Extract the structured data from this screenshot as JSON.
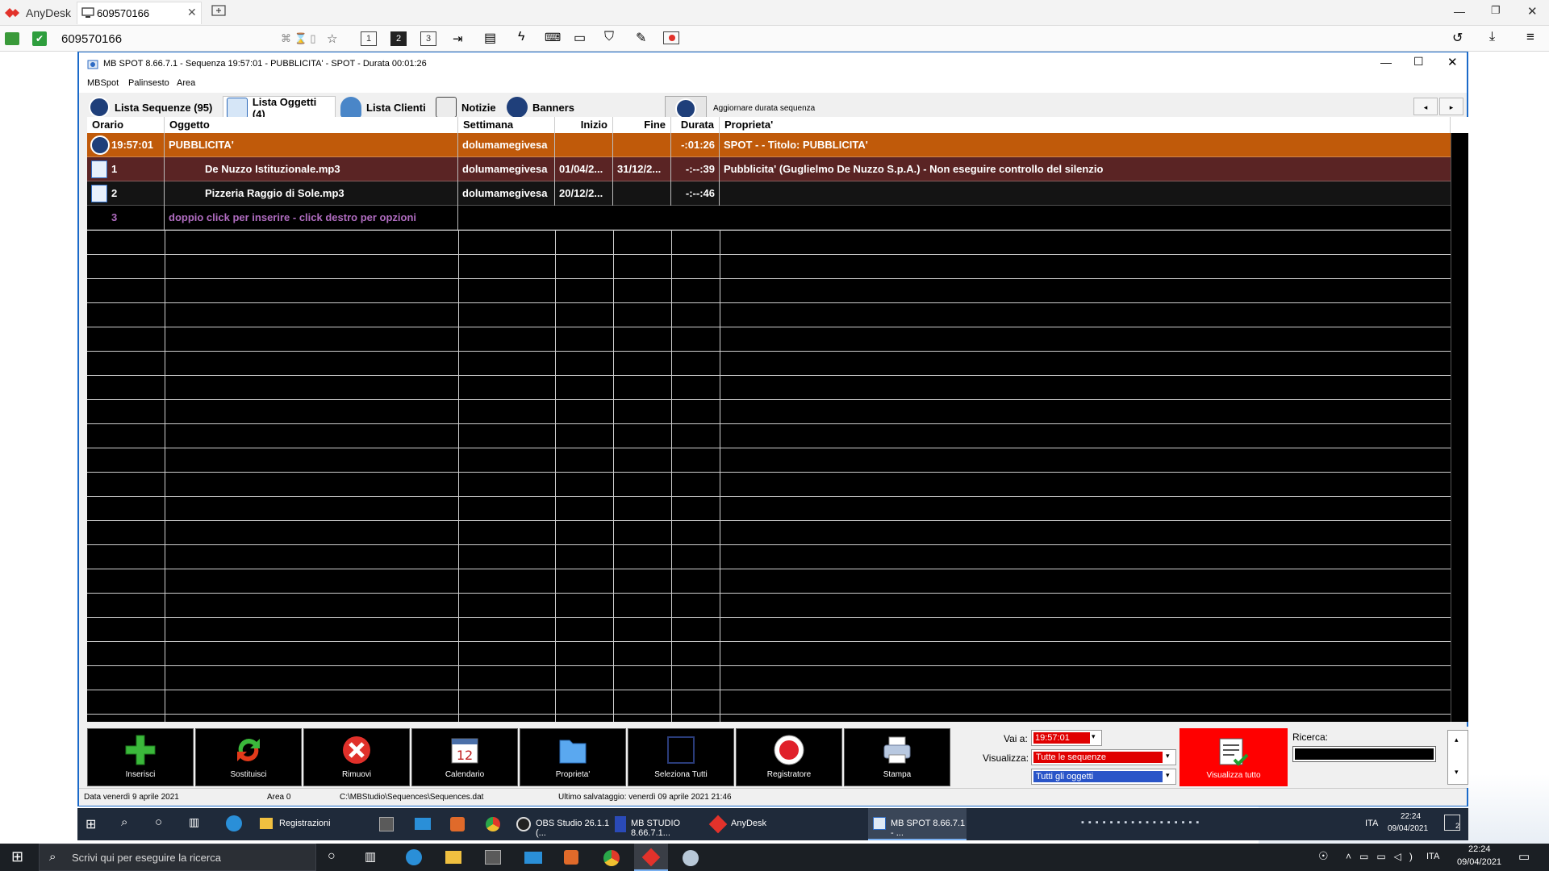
{
  "anydesk": {
    "brand": "AnyDesk",
    "tab_id": "609570166",
    "address": "609570166",
    "display_buttons": [
      "1",
      "2",
      "3"
    ]
  },
  "mbspot": {
    "title": "MB SPOT 8.66.7.1 - Sequenza 19:57:01 - PUBBLICITA' - SPOT - Durata 00:01:26",
    "menu": [
      "MBSpot",
      "Palinsesto",
      "Area"
    ],
    "tabs": [
      {
        "label": "Lista Sequenze (95)"
      },
      {
        "label": "Lista Oggetti (4)"
      },
      {
        "label": "Lista Clienti"
      },
      {
        "label": "Notizie"
      },
      {
        "label": "Banners"
      }
    ],
    "update_label": "Aggiornare durata sequenza",
    "columns": [
      "Orario",
      "Oggetto",
      "Settimana",
      "Inizio",
      "Fine",
      "Durata",
      "Proprieta'"
    ],
    "rows": [
      {
        "orario": "19:57:01",
        "oggetto": "PUBBLICITA'",
        "settimana": "dolumamegivesa",
        "inizio": "",
        "fine": "",
        "durata": "-:01:26",
        "proprieta": "SPOT -  - Titolo: PUBBLICITA'"
      },
      {
        "orario": "1",
        "oggetto": "De Nuzzo Istituzionale.mp3",
        "settimana": "dolumamegivesa",
        "inizio": "01/04/2...",
        "fine": "31/12/2...",
        "durata": "-:--:39",
        "proprieta": "Pubblicita' (Guglielmo De Nuzzo S.p.A.) - Non eseguire controllo del silenzio"
      },
      {
        "orario": "2",
        "oggetto": "Pizzeria Raggio di Sole.mp3",
        "settimana": "dolumamegivesa",
        "inizio": "20/12/2...",
        "fine": "",
        "durata": "-:--:46",
        "proprieta": ""
      },
      {
        "orario": "3",
        "oggetto": "doppio click per inserire - click destro per opzioni",
        "settimana": "",
        "inizio": "",
        "fine": "",
        "durata": "",
        "proprieta": ""
      }
    ],
    "toolbar": [
      "Inserisci",
      "Sostituisci",
      "Rimuovi",
      "Calendario",
      "Proprieta'",
      "Seleziona Tutti",
      "Registratore",
      "Stampa"
    ],
    "calendar_day": "12",
    "vai_label": "Vai a:",
    "vai_value": "19:57:01",
    "visualizza_label": "Visualizza:",
    "visualizza_value": "Tutte le sequenze",
    "oggetti_value": "Tutti gli oggetti",
    "visualizza_tutto": "Visualizza tutto",
    "ricerca_label": "Ricerca:",
    "status": {
      "date": "Data venerdì 9 aprile 2021",
      "area": "Area 0",
      "path": "C:\\MBStudio\\Sequences\\Sequences.dat",
      "saved": "Ultimo salvataggio: venerdì 09 aprile 2021 21:46"
    }
  },
  "inner_taskbar": {
    "apps": [
      "Registrazioni",
      "OBS Studio 26.1.1 (...",
      "MB STUDIO 8.66.7.1...",
      "AnyDesk",
      "MB SPOT 8.66.7.1 - ..."
    ],
    "lang": "ITA",
    "time": "22:24",
    "date": "09/04/2021",
    "notif": "2"
  },
  "taskbar": {
    "search_placeholder": "Scrivi qui per eseguire la ricerca",
    "lang": "ITA",
    "time": "22:24",
    "date": "09/04/2021"
  },
  "colors": {
    "seq_row": "#c05a0a",
    "item_row": "#5a2424",
    "item_row2": "#141414",
    "placeholder_text": "#b06cc0",
    "accent_red": "#ff0000"
  }
}
